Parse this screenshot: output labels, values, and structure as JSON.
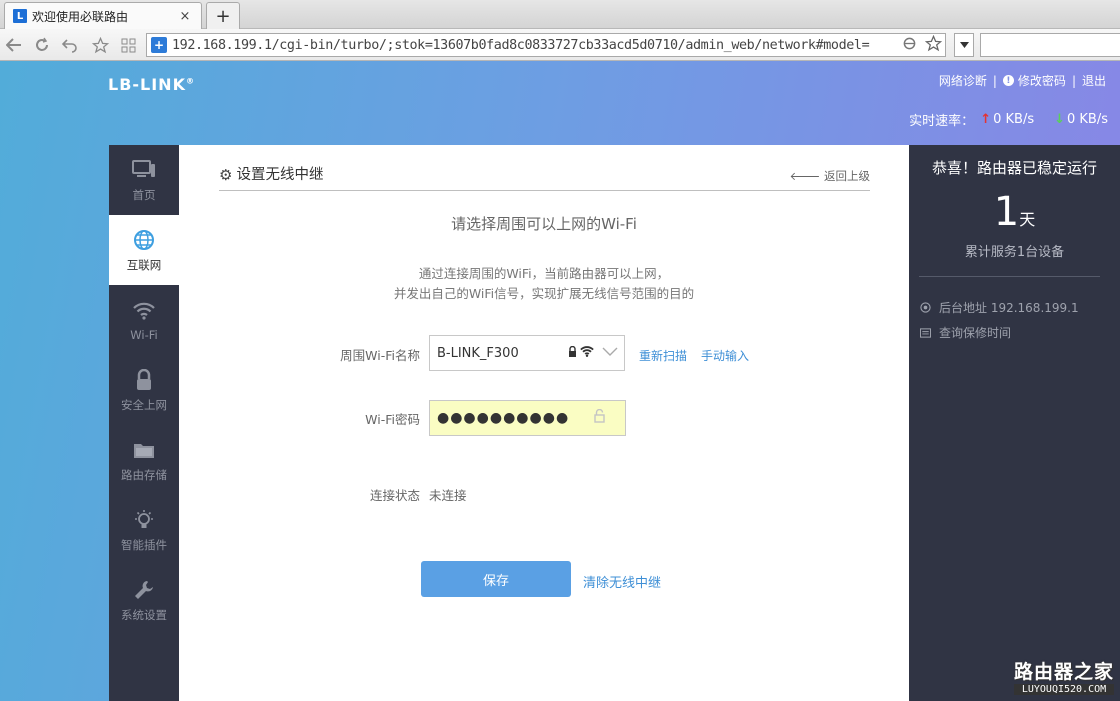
{
  "browser": {
    "tab_title": "欢迎使用必联路由",
    "tab_close": "×",
    "new_tab": "+",
    "url": "192.168.199.1/cgi-bin/turbo/;stok=13607b0fad8c0833727cb33acd5d0710/admin_web/network#model="
  },
  "header": {
    "logo": "LB-LINK",
    "logo_mark": "®",
    "links": {
      "diagnose": "网络诊断",
      "separator": "|",
      "change_password": "修改密码",
      "logout": "退出"
    },
    "speed": {
      "label": "实时速率：",
      "up_arrow": "↑",
      "up": "0 KB/s",
      "down_arrow": "↓",
      "down": "0 KB/s"
    }
  },
  "sidebar": {
    "items": [
      {
        "label": "首页",
        "icon": "monitor-icon",
        "active": false
      },
      {
        "label": "互联网",
        "icon": "globe-icon",
        "active": true
      },
      {
        "label": "Wi-Fi",
        "icon": "wifi-icon",
        "active": false
      },
      {
        "label": "安全上网",
        "icon": "lock-icon",
        "active": false
      },
      {
        "label": "路由存储",
        "icon": "folder-icon",
        "active": false
      },
      {
        "label": "智能插件",
        "icon": "bulb-icon",
        "active": false
      },
      {
        "label": "系统设置",
        "icon": "wrench-icon",
        "active": false
      }
    ]
  },
  "main": {
    "title": "设置无线中继",
    "back": "返回上级",
    "heading": "请选择周围可以上网的Wi-Fi",
    "desc_line1": "通过连接周围的WiFi，当前路由器可以上网，",
    "desc_line2": "并发出自己的WiFi信号，实现扩展无线信号范围的目的",
    "form": {
      "ssid_label": "周围Wi-Fi名称",
      "ssid_value": "B-LINK_F300",
      "rescan": "重新扫描",
      "manual": "手动输入",
      "password_label": "Wi-Fi密码",
      "password_value": "●●●●●●●●●●",
      "status_label": "连接状态",
      "status_value": "未连接"
    },
    "save": "保存",
    "clear": "清除无线中继"
  },
  "right_panel": {
    "title": "恭喜！路由器已稳定运行",
    "days": "1",
    "days_unit": "天",
    "served": "累计服务1台设备",
    "admin_address": "后台地址 192.168.199.1",
    "warranty": "查询保修时间"
  },
  "watermark": {
    "main": "路由器之家",
    "sub": "LUYOUQI520.COM"
  },
  "colors": {
    "accent": "#5aa0e4",
    "link": "#3e8fd6",
    "sidebar_bg": "#303444",
    "password_bg": "#fafdc3"
  }
}
